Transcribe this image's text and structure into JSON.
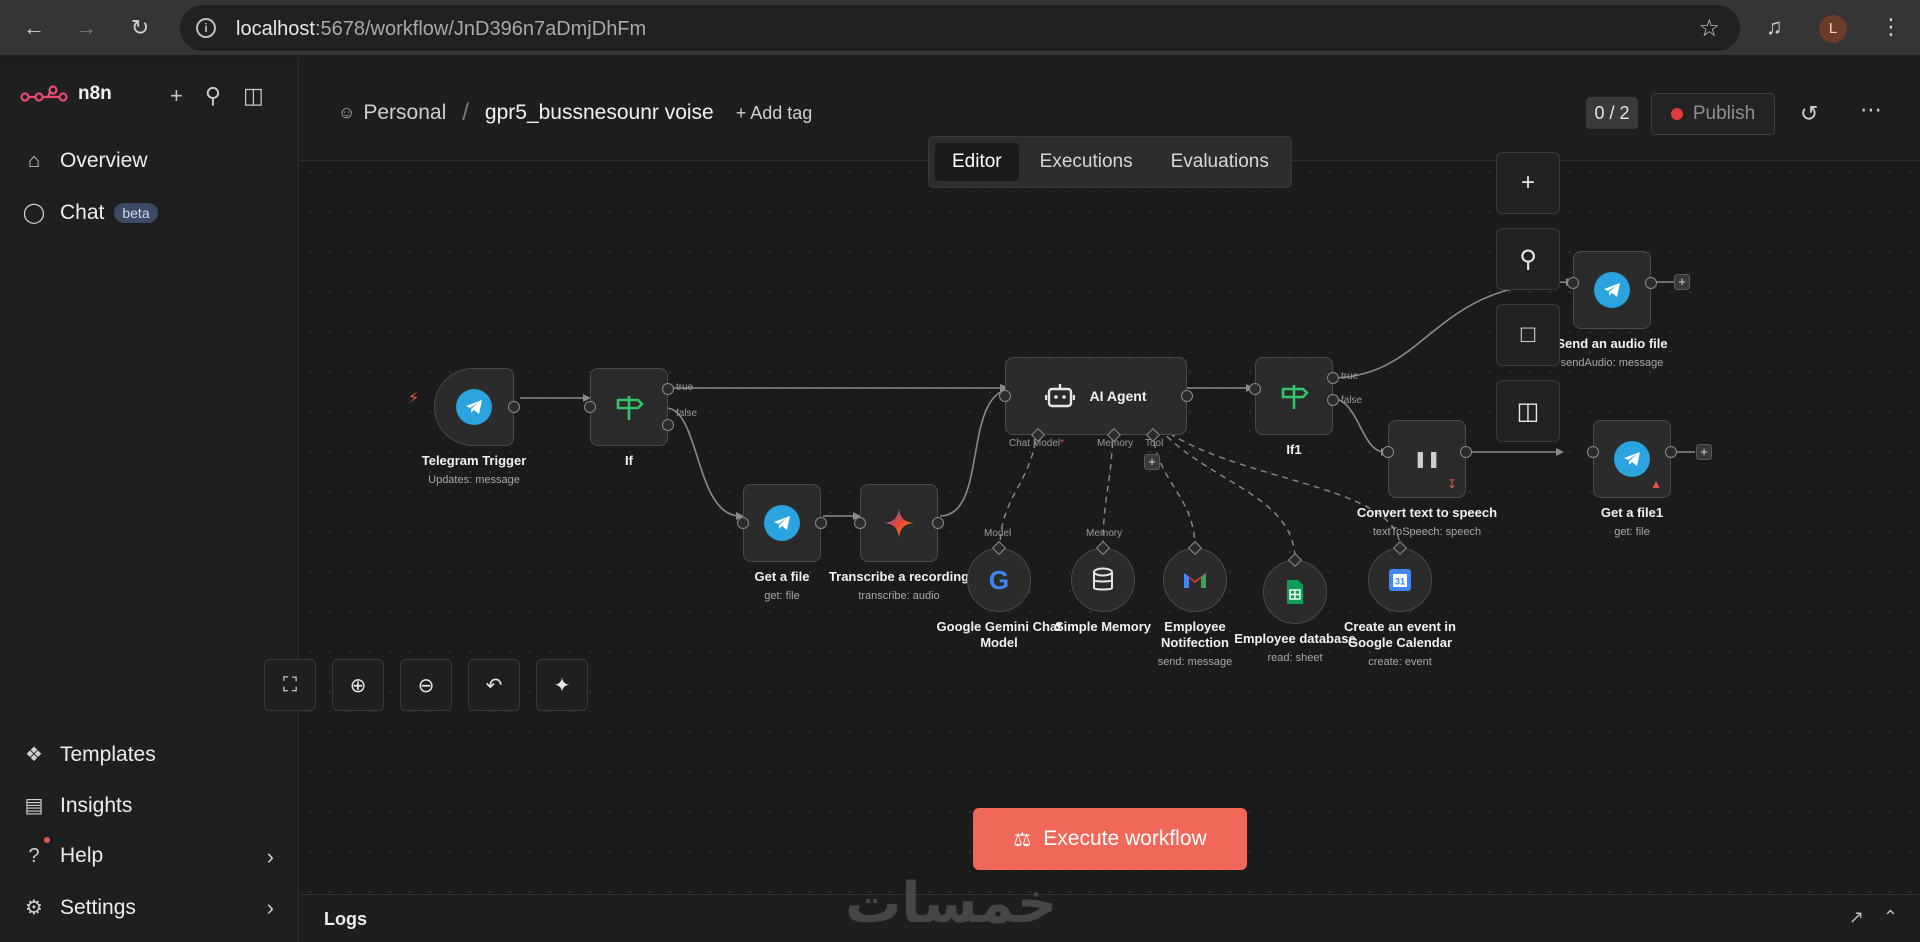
{
  "browser": {
    "url_host": "localhost",
    "url_rest": ":5678/workflow/JnD396n7aDmjDhFm",
    "avatar_letter": "L"
  },
  "sidebar": {
    "brand": "n8n",
    "overview": "Overview",
    "chat": "Chat",
    "chat_badge": "beta",
    "templates": "Templates",
    "insights": "Insights",
    "help": "Help",
    "settings": "Settings"
  },
  "header": {
    "project": "Personal",
    "workflow_name": "gpr5_bussnesounr voise",
    "add_tag": "+ Add tag",
    "counter": "0 / 2",
    "publish": "Publish",
    "tabs": [
      "Editor",
      "Executions",
      "Evaluations"
    ],
    "active_tab": "Editor"
  },
  "nodes": {
    "telegram_trigger": {
      "name": "Telegram Trigger",
      "sub": "Updates: message"
    },
    "if": {
      "name": "If",
      "true": "true",
      "false": "false"
    },
    "get_file": {
      "name": "Get a file",
      "sub": "get: file"
    },
    "transcribe": {
      "name": "Transcribe a recording",
      "sub": "transcribe: audio"
    },
    "ai_agent": {
      "name": "AI Agent",
      "chat_model": "Chat Model",
      "memory": "Memory",
      "tool": "Tool"
    },
    "if1": {
      "name": "If1",
      "true": "true",
      "false": "false"
    },
    "send_audio": {
      "name": "Send an audio file",
      "sub": "sendAudio: message"
    },
    "tts": {
      "name": "Convert text to speech",
      "sub": "textToSpeech: speech"
    },
    "get_file1": {
      "name": "Get a file1",
      "sub": "get: file"
    },
    "gemini": {
      "name": "Google Gemini Chat Model",
      "top": "Model"
    },
    "memory": {
      "name": "Simple Memory",
      "top": "Memory"
    },
    "gmail": {
      "name": "Employee Notifection",
      "sub": "send: message"
    },
    "sheets": {
      "name": "Employee database",
      "sub": "read: sheet"
    },
    "calendar": {
      "name": "Create an event in Google Calendar",
      "sub": "create: event"
    }
  },
  "canvas": {
    "execute": "Execute workflow"
  },
  "logs": {
    "title": "Logs"
  },
  "watermark": "خمسات",
  "colors": {
    "accent": "#f0685a",
    "telegram": "#2aa3df",
    "wire": "#8a8a8a"
  }
}
